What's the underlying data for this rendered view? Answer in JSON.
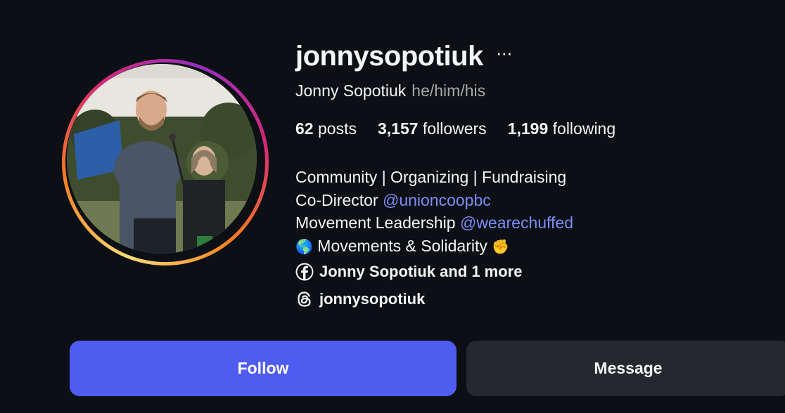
{
  "profile": {
    "username": "jonnysopotiuk",
    "more_label": "···",
    "full_name": "Jonny Sopotiuk",
    "pronouns": "he/him/his"
  },
  "stats": {
    "posts_count": "62",
    "posts_label": "posts",
    "followers_count": "3,157",
    "followers_label": "followers",
    "following_count": "1,199",
    "following_label": "following"
  },
  "bio": {
    "line1": "Community | Organizing | Fundraising",
    "line2_text": "Co-Director ",
    "line2_mention": "@unioncoopbc",
    "line3_text": "Movement Leadership ",
    "line3_mention": "@wearechuffed",
    "line4_emoji_start": "🌎",
    "line4_text": " Movements & Solidarity ",
    "line4_emoji_end": "✊"
  },
  "links": {
    "facebook_text": "Jonny Sopotiuk and 1 more",
    "threads_text": "jonnysopotiuk"
  },
  "actions": {
    "follow_label": "Follow",
    "message_label": "Message"
  },
  "colors": {
    "background": "#0c1014",
    "follow_button": "#4f5cf0",
    "message_button": "#25292e",
    "mention": "#7a8df7",
    "secondary_text": "#a8a8a8"
  }
}
